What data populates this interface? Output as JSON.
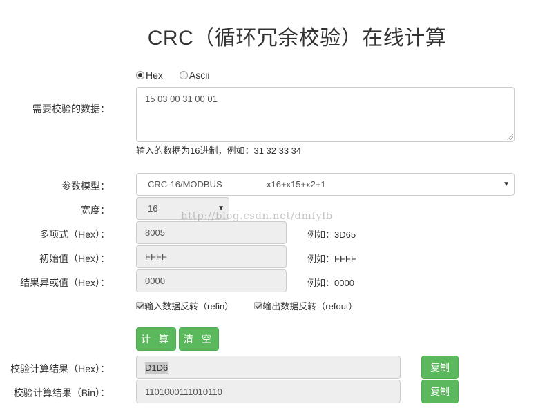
{
  "header": {
    "title": "CRC（循环冗余校验）在线计算"
  },
  "input_format": {
    "options": [
      {
        "label": "Hex",
        "checked": true
      },
      {
        "label": "Ascii",
        "checked": false
      }
    ]
  },
  "data_section": {
    "label": "需要校验的数据：",
    "value": "15 03 00 31 00 01",
    "hint": "输入的数据为16进制，例如：31 32 33 34"
  },
  "model": {
    "label": "参数模型：",
    "selected_name": "CRC-16/MODBUS",
    "selected_poly": "x16+x15+x2+1"
  },
  "width": {
    "label": "宽度：",
    "selected": "16"
  },
  "polynomial": {
    "label": "多项式（Hex）：",
    "value": "8005",
    "example": "例如：3D65"
  },
  "init": {
    "label": "初始值（Hex）：",
    "value": "FFFF",
    "example": "例如：FFFF"
  },
  "xorout": {
    "label": "结果异或值（Hex）：",
    "value": "0000",
    "example": "例如：0000"
  },
  "options": {
    "refin_label": "输入数据反转（refin）",
    "refout_label": "输出数据反转（refout）"
  },
  "actions": {
    "calculate_label": "计 算",
    "clear_label": "清 空"
  },
  "result_hex": {
    "label": "校验计算结果（Hex）：",
    "value": "D1D6",
    "copy_label": "复制"
  },
  "result_bin": {
    "label": "校验计算结果（Bin）：",
    "value": "1101000111010110",
    "copy_label": "复制"
  },
  "watermark": "http://blog.csdn.net/dmfylb",
  "colors": {
    "accent_green": "#5cb85c",
    "input_disabled_bg": "#eeeeee",
    "border": "#cccccc"
  }
}
